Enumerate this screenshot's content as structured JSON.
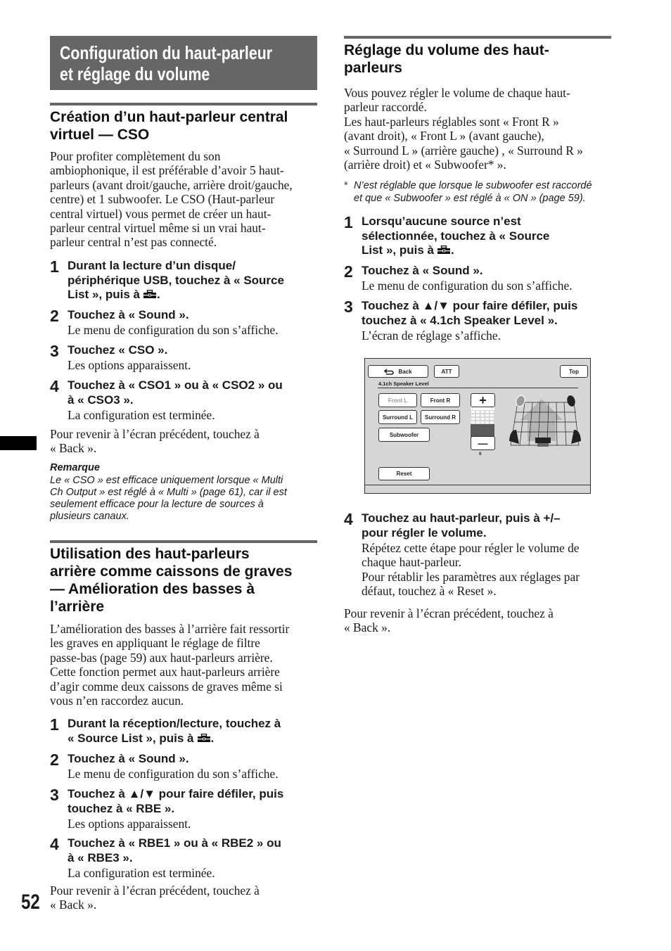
{
  "chapter_title_lines": [
    "Configuration du haut-parleur",
    "et réglage du volume"
  ],
  "cso_section": {
    "heading_lines": [
      "Création d’un haut-parleur central",
      "virtuel — CSO"
    ],
    "intro_lines": [
      "Pour profiter complètement du son",
      "ambiophonique, il est préférable d’avoir 5 haut-",
      "parleurs (avant droit/gauche, arrière droit/gauche,",
      "centre) et 1 subwoofer. Le CSO (Haut-parleur",
      "central virtuel) vous permet de créer un haut-",
      "parleur central virtuel même si un vrai haut-",
      "parleur central n’est pas connecté."
    ],
    "steps": [
      {
        "num": "1",
        "title_lines": [
          "Durant la lecture d’un disque/",
          "périphérique USB, touchez à « Source",
          "List », puis à"
        ],
        "title_suffix": ".",
        "icon": "toolbox-icon",
        "desc_lines": []
      },
      {
        "num": "2",
        "title_lines": [
          "Touchez à « Sound »."
        ],
        "desc_lines": [
          "Le menu de configuration du son s’affiche."
        ]
      },
      {
        "num": "3",
        "title_lines": [
          "Touchez « CSO »."
        ],
        "desc_lines": [
          "Les options apparaissent."
        ]
      },
      {
        "num": "4",
        "title_lines": [
          "Touchez à « CSO1 » ou à « CSO2 » ou",
          "à « CSO3 »."
        ],
        "desc_lines": [
          "La configuration est terminée."
        ]
      }
    ],
    "back_lines": [
      "Pour revenir à l’écran précédent, touchez à",
      "« Back »."
    ],
    "note_title": "Remarque",
    "note_lines": [
      "Le « CSO » est efficace uniquement lorsque « Multi",
      "Ch Output » est réglé à « Multi » (page 61), car il est",
      "seulement efficace pour la lecture de sources à",
      "plusieurs canaux."
    ]
  },
  "rbe_section": {
    "heading_lines": [
      "Utilisation des haut-parleurs",
      "arrière comme caissons de graves",
      "— Amélioration des basses à",
      "l’arrière"
    ],
    "intro_lines": [
      "L’amélioration des basses à l’arrière fait ressortir",
      "les graves en appliquant le réglage de filtre",
      "passe-bas (page 59) aux haut-parleurs arrière.",
      "Cette fonction permet aux haut-parleurs arrière",
      "d’agir comme deux caissons de graves même si",
      "vous n’en raccordez aucun."
    ],
    "steps": [
      {
        "num": "1",
        "title_lines": [
          "Durant la réception/lecture, touchez à",
          "« Source List », puis à"
        ],
        "title_suffix": ".",
        "icon": "toolbox-icon",
        "desc_lines": []
      },
      {
        "num": "2",
        "title_lines": [
          "Touchez à « Sound »."
        ],
        "desc_lines": [
          "Le menu de configuration du son s’affiche."
        ]
      },
      {
        "num": "3",
        "title_lines": [
          "Touchez à ▲/▼ pour faire défiler, puis",
          "touchez à « RBE »."
        ],
        "desc_lines": [
          "Les options apparaissent."
        ]
      },
      {
        "num": "4",
        "title_lines": [
          "Touchez à « RBE1 » ou à « RBE2 » ou",
          "à « RBE3 »."
        ],
        "desc_lines": [
          "La configuration est terminée."
        ]
      }
    ],
    "back_lines": [
      "Pour revenir à l’écran précédent, touchez à",
      "« Back »."
    ]
  },
  "volume_section": {
    "heading_lines": [
      "Réglage du volume des haut-",
      "parleurs"
    ],
    "intro_lines": [
      "Vous pouvez régler le volume de chaque haut-",
      "parleur raccordé.",
      "Les haut-parleurs réglables sont « Front R »",
      "(avant droit), « Front L » (avant gauche),",
      "« Surround L » (arrière gauche) , « Surround R »",
      "(arrière droit) et « Subwoofer* »."
    ],
    "footnote_mark": "*",
    "footnote_lines": [
      "N’est réglable que lorsque le subwoofer est raccordé",
      "et que « Subwoofer » est réglé à « ON » (page 59)."
    ],
    "steps": [
      {
        "num": "1",
        "title_lines": [
          "Lorsqu’aucune source n’est",
          "sélectionnée, touchez à « Source",
          "List », puis à"
        ],
        "title_suffix": ".",
        "icon": "toolbox-icon",
        "desc_lines": []
      },
      {
        "num": "2",
        "title_lines": [
          "Touchez à « Sound »."
        ],
        "desc_lines": [
          "Le menu de configuration du son s’affiche."
        ]
      },
      {
        "num": "3",
        "title_lines": [
          "Touchez à ▲/▼ pour faire défiler, puis",
          "touchez à « 4.1ch Speaker Level »."
        ],
        "desc_lines": [
          "L’écran de réglage s’affiche."
        ]
      },
      {
        "num": "4",
        "title_lines": [
          "Touchez au haut-parleur, puis à +/–",
          "pour régler le volume."
        ],
        "desc_lines": [
          "Répétez cette étape pour régler le volume de",
          "chaque haut-parleur.",
          "Pour rétablir les paramètres aux réglages par",
          "défaut, touchez à « Reset »."
        ]
      }
    ],
    "back_lines": [
      "Pour revenir à l’écran précédent, touchez à",
      "« Back »."
    ],
    "screen": {
      "back_label": "Back",
      "att_label": "ATT",
      "top_label": "Top",
      "title": "4.1ch Speaker Level",
      "speakers": [
        "Front L",
        "Front R",
        "Surround L",
        "Surround R",
        "Subwoofer"
      ],
      "selected_speaker": "Front L",
      "plus_label": "+",
      "minus_label": "—",
      "level_value": "0",
      "level_fill_fraction": 0.5,
      "reset_label": "Reset"
    }
  },
  "page_number": "52",
  "colors": {
    "title_bar": "#666666",
    "rule": "#666666",
    "screen_bg": "#d6d6d6",
    "level_fill": "#5a5a5a"
  }
}
